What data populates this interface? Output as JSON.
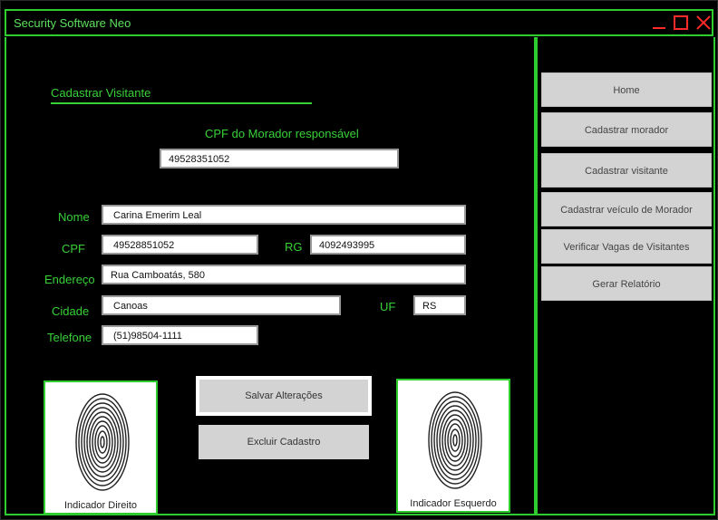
{
  "window": {
    "title": "Security Software Neo"
  },
  "form": {
    "section_title": "Cadastrar Visitante",
    "cpf_resp_label": "CPF do Morador responsável",
    "cpf_resp_value": "49528351052",
    "nome_label": "Nome",
    "nome_value": "Carina Emerim Leal",
    "cpf_label": "CPF",
    "cpf_value": "49528851052",
    "rg_label": "RG",
    "rg_value": "4092493995",
    "endereco_label": "Endereço",
    "endereco_value": "Rua Camboatás, 580",
    "cidade_label": "Cidade",
    "cidade_value": "Canoas",
    "uf_label": "UF",
    "uf_value": "RS",
    "telefone_label": "Telefone",
    "telefone_value": "(51)98504-1111"
  },
  "actions": {
    "save": "Salvar Alterações",
    "delete": "Excluir Cadastro"
  },
  "fingerprints": {
    "right": "Indicador Direito",
    "left": "Indicador Esquerdo"
  },
  "sidebar": {
    "items": [
      {
        "label": "Home"
      },
      {
        "label": "Cadastrar morador"
      },
      {
        "label": "Cadastrar visitante"
      },
      {
        "label": "Cadastrar veículo de Morador"
      },
      {
        "label": "Verificar Vagas de Visitantes"
      },
      {
        "label": "Gerar Relatório"
      }
    ]
  },
  "colors": {
    "accent": "#38d138",
    "window_controls": "#ff2a2a",
    "background": "#000000"
  }
}
